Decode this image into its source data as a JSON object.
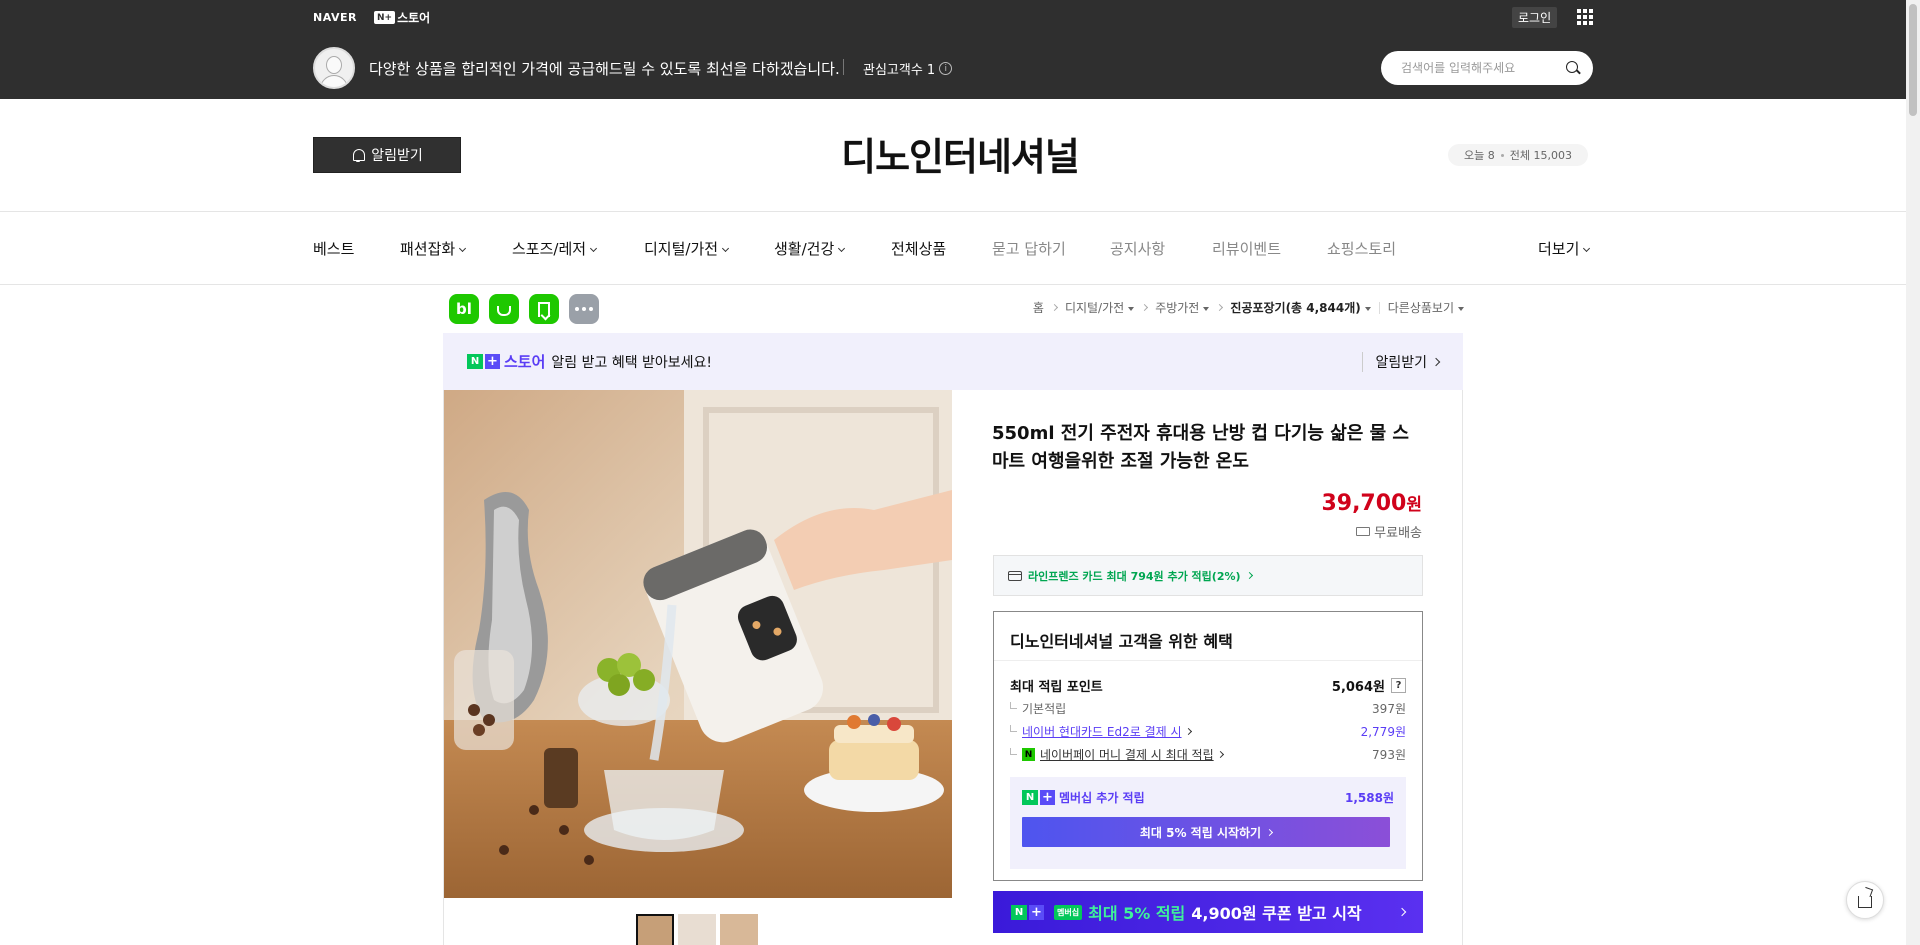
{
  "topbar": {
    "naver": "NAVER",
    "nstore_n": "N+",
    "nstore_label": "스토어",
    "login": "로그인",
    "slogan": "다양한 상품을 합리적인 가격에 공급해드릴 수 있도록 최선을 다하겠습니다.",
    "fans": "관심고객수 1",
    "search_placeholder": "검색어를 입력해주세요"
  },
  "store": {
    "alarm_label": "알림받기",
    "title": "디노인터네셔널",
    "today": "오늘 8",
    "total": "전체 15,003"
  },
  "nav": [
    {
      "label": "베스트"
    },
    {
      "label": "패션잡화"
    },
    {
      "label": "스포즈/레저"
    },
    {
      "label": "디지털/가전"
    },
    {
      "label": "생활/건강"
    },
    {
      "label": "전체상품"
    },
    {
      "label": "묻고 답하기"
    },
    {
      "label": "공지사항"
    },
    {
      "label": "리뷰이벤트"
    },
    {
      "label": "쇼핑스토리"
    },
    {
      "label": "더보기"
    }
  ],
  "share": {
    "blog": "bl"
  },
  "breadcrumb": {
    "home": "홈",
    "cat1": "디지털/가전",
    "cat2": "주방가전",
    "cat3": "진공포장기",
    "count": "(총 4,844개)",
    "other": "다른상품보기"
  },
  "banner": {
    "store_label": "스토어",
    "message": "알림 받고 혜택 받아보세요!",
    "alarm_link": "알림받기"
  },
  "product": {
    "title": "550ml 전기 주전자 휴대용 난방 컵 다기능 삶은 물 스마트 여행을위한 조절 가능한 온도",
    "price": "39,700",
    "currency": "원",
    "shipping": "무료배송",
    "card_offer": "라인프렌즈 카드 최대 794원 추가 적립(2%)"
  },
  "benefits": {
    "title": "디노인터네셔널 고객을 위한 혜택",
    "max_points_label": "최대 적립 포인트",
    "max_points_value": "5,064원",
    "basic_label": "기본적립",
    "basic_value": "397원",
    "hyundai_label": "네이버 현대카드 Ed2로 결제 시",
    "hyundai_value": "2,779원",
    "npay_label": "네이버페이 머니 결제 시 최대 적립",
    "npay_value": "793원",
    "membership_label": "멤버십 추가 적립",
    "membership_value": "1,588원",
    "membership_button": "최대 5% 적립 시작하기"
  },
  "coupon": {
    "badge": "멤버십",
    "text_highlight": "최대 5% 적립",
    "text_rest": "4,900원 쿠폰 받고 시작"
  },
  "colors": {
    "topbar_bg": "#2f2f2f",
    "price_red": "#d0021b",
    "naver_green": "#03c75a",
    "accent_purple": "#5a3df5"
  }
}
